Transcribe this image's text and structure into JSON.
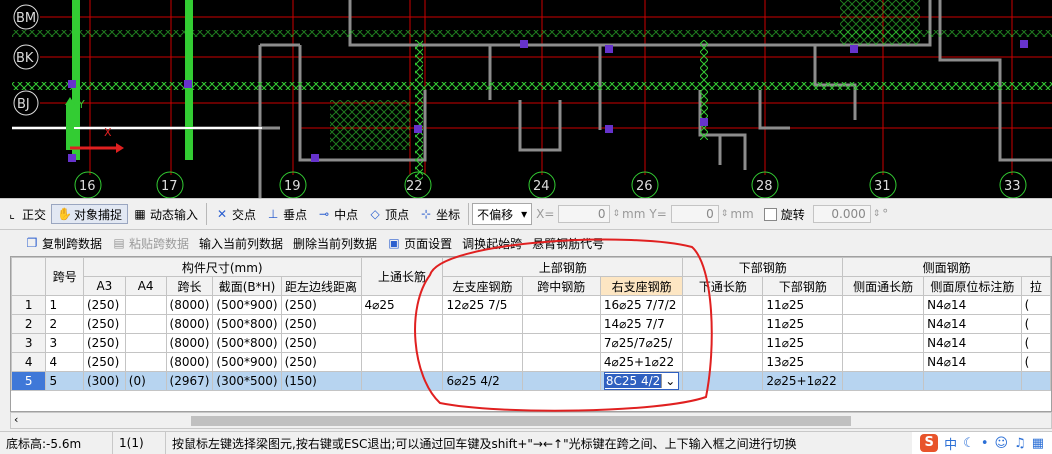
{
  "cad": {
    "row_labels": [
      "BM",
      "BK",
      "BJ"
    ],
    "col_labels": [
      "16",
      "17",
      "19",
      "22",
      "24",
      "26",
      "28",
      "31",
      "33"
    ],
    "ucs_y": "Y",
    "ucs_x": "X"
  },
  "toolbar": {
    "ortho": "正交",
    "snap": "对象捕捉",
    "dynamic": "动态输入",
    "intersect": "交点",
    "perpendicular": "垂点",
    "midpoint": "中点",
    "vertex": "顶点",
    "coord": "坐标",
    "offset_select": "不偏移",
    "x_label": "X=",
    "x_value": "0",
    "y_label": "Y=",
    "y_value": "0",
    "mm1": "mm",
    "mm2": "mm",
    "rotate": "旋转",
    "rotate_value": "0.000",
    "deg": "°"
  },
  "actions": {
    "copy_span": "复制跨数据",
    "paste_span": "粘贴跨数据",
    "input_col": "输入当前列数据",
    "delete_col": "删除当前列数据",
    "page_setup": "页面设置",
    "adjust_start": "调换起始跨",
    "cantilever": "悬臂钢筋代号"
  },
  "grid": {
    "header1": {
      "span_no": "跨号",
      "member_size": "构件尺寸(mm)",
      "top_through": "上通长筋",
      "top_rebar": "上部钢筋",
      "bottom_rebar": "下部钢筋",
      "side_rebar": "侧面钢筋"
    },
    "header2": {
      "a3": "A3",
      "a4": "A4",
      "span_len": "跨长",
      "section": "截面(B*H)",
      "dist_left": "距左边线距离",
      "left_support": "左支座钢筋",
      "mid_span": "跨中钢筋",
      "right_support": "右支座钢筋",
      "bottom_through": "下通长筋",
      "bottom_rebar2": "下部钢筋",
      "side_through": "侧面通长筋",
      "side_original": "侧面原位标注筋",
      "extra": "拉"
    },
    "rows": [
      {
        "rn": "1",
        "span": "1",
        "a3": "(250)",
        "a4": "",
        "len": "(8000)",
        "sec": "(500*900)",
        "dist": "(250)",
        "top": "4⌀25",
        "left": "12⌀25 7/5",
        "mid": "",
        "right": "16⌀25 7/7/2",
        "bthrough": "",
        "bottom": "11⌀25",
        "sthrough": "",
        "sorig": "N4⌀14",
        "extra": "("
      },
      {
        "rn": "2",
        "span": "2",
        "a3": "(250)",
        "a4": "",
        "len": "(8000)",
        "sec": "(500*800)",
        "dist": "(250)",
        "top": "",
        "left": "",
        "mid": "",
        "right": "14⌀25 7/7",
        "bthrough": "",
        "bottom": "11⌀25",
        "sthrough": "",
        "sorig": "N4⌀14",
        "extra": "("
      },
      {
        "rn": "3",
        "span": "3",
        "a3": "(250)",
        "a4": "",
        "len": "(8000)",
        "sec": "(500*800)",
        "dist": "(250)",
        "top": "",
        "left": "",
        "mid": "",
        "right": "7⌀25/7⌀25/",
        "bthrough": "",
        "bottom": "11⌀25",
        "sthrough": "",
        "sorig": "N4⌀14",
        "extra": "("
      },
      {
        "rn": "4",
        "span": "4",
        "a3": "(250)",
        "a4": "",
        "len": "(8000)",
        "sec": "(500*900)",
        "dist": "(250)",
        "top": "",
        "left": "",
        "mid": "",
        "right": "4⌀25+1⌀22",
        "bthrough": "",
        "bottom": "13⌀25",
        "sthrough": "",
        "sorig": "N4⌀14",
        "extra": "("
      },
      {
        "rn": "5",
        "span": "5",
        "a3": "(300)",
        "a4": "(0)",
        "len": "(2967)",
        "sec": "(300*500)",
        "dist": "(150)",
        "top": "",
        "left": "6⌀25 4/2",
        "mid": "",
        "right": "8C25 4/2",
        "bthrough": "",
        "bottom": "2⌀25+1⌀22",
        "sthrough": "",
        "sorig": "",
        "extra": ""
      }
    ]
  },
  "status": {
    "elevation": "底标高:-5.6m",
    "span_idx": "1(1)",
    "hint": "按鼠标左键选择梁图元,按右键或ESC退出;可以通过回车键及shift+\"→←↑\"光标键在跨之间、上下输入框之间进行切换",
    "ime_logo": "S",
    "ime_mode": "中"
  },
  "colors": {
    "cad_bg": "#000000",
    "wall": "#8c8c8c",
    "beam_hatch": "#33cc33",
    "axis_line": "#cc0000",
    "column": "#6633cc",
    "annotation": "#e02020",
    "selection": "#b7d4f0"
  }
}
